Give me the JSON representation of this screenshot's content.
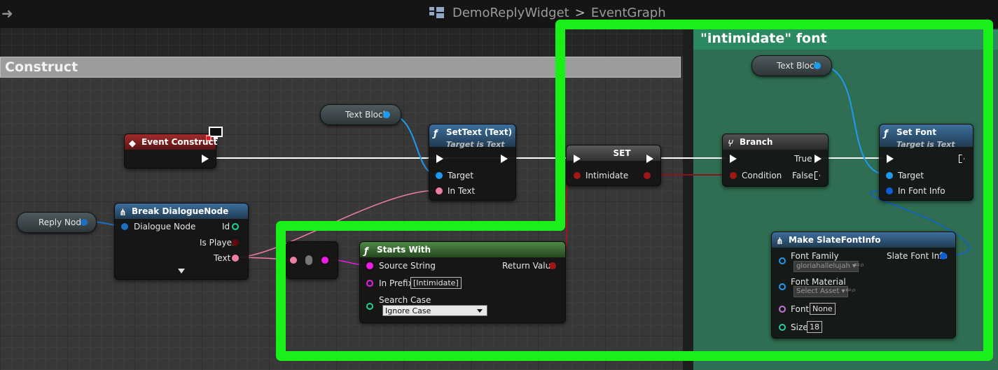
{
  "breadcrumb": {
    "asset": "DemoReplyWidget",
    "separator": ">",
    "graph": "EventGraph"
  },
  "comments": {
    "construct": "Construct",
    "intimidate": "\"intimidate\" font"
  },
  "variables": {
    "reply_node": "Reply Node",
    "text_block_1": "Text Block",
    "text_block_2": "Text Block"
  },
  "nodes": {
    "event_construct": {
      "title": "Event Construct"
    },
    "break_dialogue": {
      "title": "Break DialogueNode",
      "input": "Dialogue Node",
      "outputs": [
        "Id",
        "Is Player",
        "Text"
      ]
    },
    "set_text": {
      "title": "SetText (Text)",
      "subtitle": "Target is Text",
      "pins": [
        "Target",
        "In Text"
      ]
    },
    "set_var": {
      "title": "SET",
      "pin": "Intimidate"
    },
    "branch": {
      "title": "Branch",
      "input": "Condition",
      "outputs": [
        "True",
        "False"
      ]
    },
    "set_font": {
      "title": "Set Font",
      "subtitle": "Target is Text",
      "pins": [
        "Target",
        "In Font Info"
      ]
    },
    "starts_with": {
      "title": "Starts With",
      "source_label": "Source String",
      "prefix_label": "In Prefix",
      "prefix_value": "[Intimidate]",
      "case_label": "Search Case",
      "case_value": "Ignore Case",
      "output": "Return Value"
    },
    "make_font": {
      "title": "Make SlateFontInfo",
      "output": "Slate Font Info",
      "family_label": "Font Family",
      "family_value": "gloriahallelujah",
      "material_label": "Font Material",
      "material_value": "Select Asset",
      "font_label": "Font",
      "font_value": "None",
      "size_label": "Size",
      "size_value": "18"
    }
  },
  "colors": {
    "highlight": "#19f019",
    "exec": "#ffffff",
    "object_pin": "#1d9bf0",
    "text_pin": "#f07fa8",
    "string_pin": "#f01de6",
    "bool_pin": "#a11717",
    "struct_pin": "#0b5fd6",
    "int_pin": "#1fd1a0"
  }
}
